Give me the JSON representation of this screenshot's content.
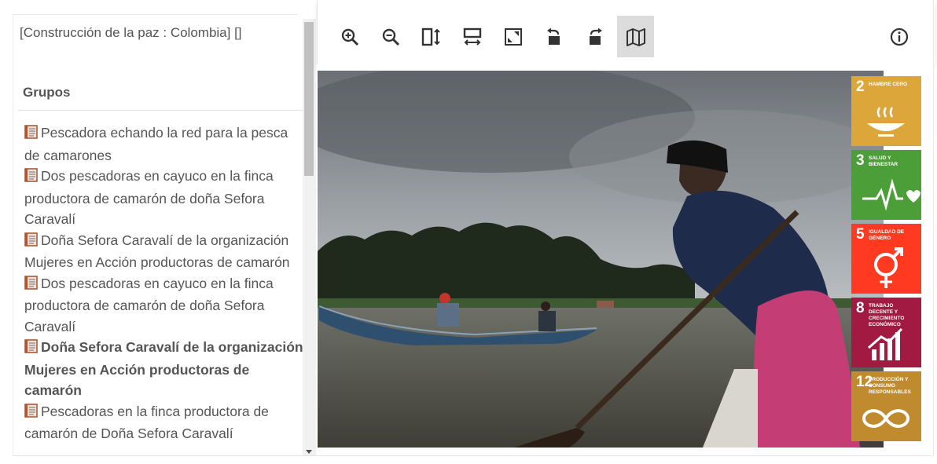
{
  "record_title": "[Construcción de la paz : Colombia] []",
  "groups_heading": "Grupos",
  "groups": [
    {
      "label": "Pescadora echando la red para la pesca de camarones",
      "active": false
    },
    {
      "label": "Dos pescadoras en cayuco en la finca productora de camarón de doña Sefora Caravalí",
      "active": false
    },
    {
      "label": "Doña Sefora Caravalí de la organización Mujeres en Acción productoras de camarón",
      "active": false
    },
    {
      "label": "Dos pescadoras en cayuco en la finca productora de camarón de doña Sefora Caravalí",
      "active": false
    },
    {
      "label": "Doña Sefora Caravalí de la organización Mujeres en Acción productoras de camarón",
      "active": true
    },
    {
      "label": "Pescadoras en la finca productora de camarón de Doña Sefora Caravalí",
      "active": false
    }
  ],
  "toolbar": {
    "buttons": [
      "zoom-in-icon",
      "zoom-out-icon",
      "fit-height-icon",
      "fit-width-icon",
      "full-size-icon",
      "rotate-left-icon",
      "rotate-right-icon",
      "map-icon"
    ],
    "active_button": "map-icon",
    "info": "info-icon"
  },
  "sdg_badges": [
    {
      "number": "2",
      "label": "HAMBRE CERO",
      "color": "#DDA63A"
    },
    {
      "number": "3",
      "label": "SALUD Y BIENESTAR",
      "color": "#4C9F38"
    },
    {
      "number": "5",
      "label": "IGUALDAD DE GÉNERO",
      "color": "#FF3A21"
    },
    {
      "number": "8",
      "label": "TRABAJO DECENTE Y CRECIMIENTO ECONÓMICO",
      "color": "#A21942"
    },
    {
      "number": "12",
      "label": "PRODUCCIÓN Y CONSUMO RESPONSABLES",
      "color": "#BF8B2E"
    }
  ],
  "colors": {
    "icon": "#333333",
    "active_button_bg": "#dcdcdc",
    "text": "#555555"
  }
}
